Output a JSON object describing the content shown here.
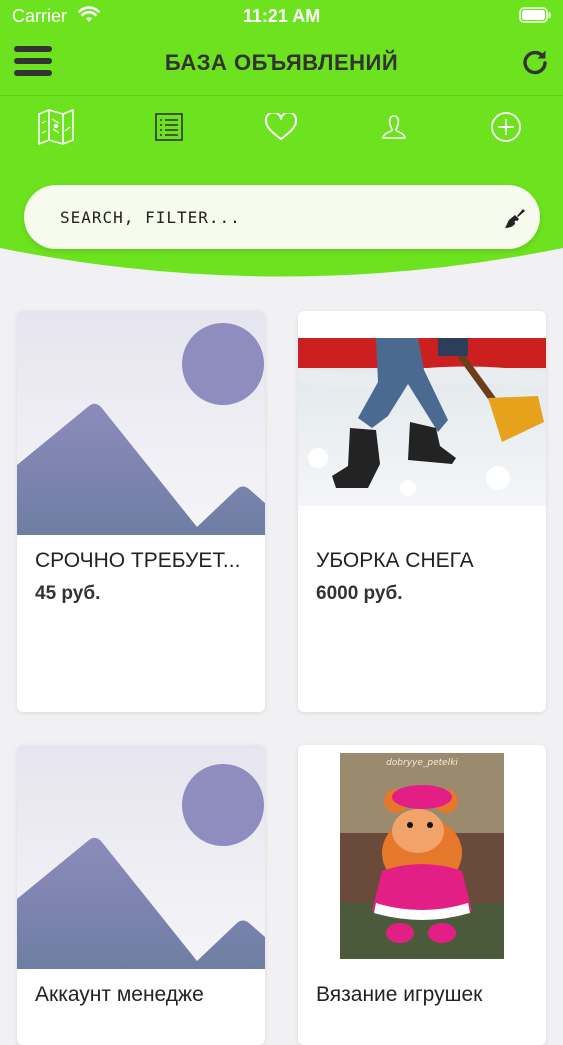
{
  "status_bar": {
    "carrier": "Carrier",
    "time": "11:21 AM"
  },
  "header": {
    "title": "БАЗА ОБЪЯВЛЕНИЙ"
  },
  "tabs": [
    {
      "name": "map",
      "icon": "map-icon"
    },
    {
      "name": "list",
      "icon": "list-icon"
    },
    {
      "name": "favorites",
      "icon": "heart-icon"
    },
    {
      "name": "profile",
      "icon": "user-icon"
    },
    {
      "name": "add",
      "icon": "plus-circle-icon"
    }
  ],
  "search": {
    "placeholder": "SEARCH, FILTER..."
  },
  "listings": [
    {
      "title": "СРОЧНО ТРЕБУЕТ...",
      "price": "45 руб.",
      "image": "placeholder-image-icon"
    },
    {
      "title": "УБОРКА СНЕГА",
      "price": "6000 руб.",
      "image": "snow-shoveling-photo"
    },
    {
      "title": "Аккаунт менедже",
      "price": "",
      "image": "placeholder-image-icon"
    },
    {
      "title": "Вязание игрушек",
      "price": "",
      "image": "knitted-toy-photo",
      "image_caption": "dobryye_petelki"
    }
  ],
  "colors": {
    "brand_green": "#6de21f",
    "text_dark": "#333333",
    "placeholder_purple": "#8e8cbf"
  }
}
